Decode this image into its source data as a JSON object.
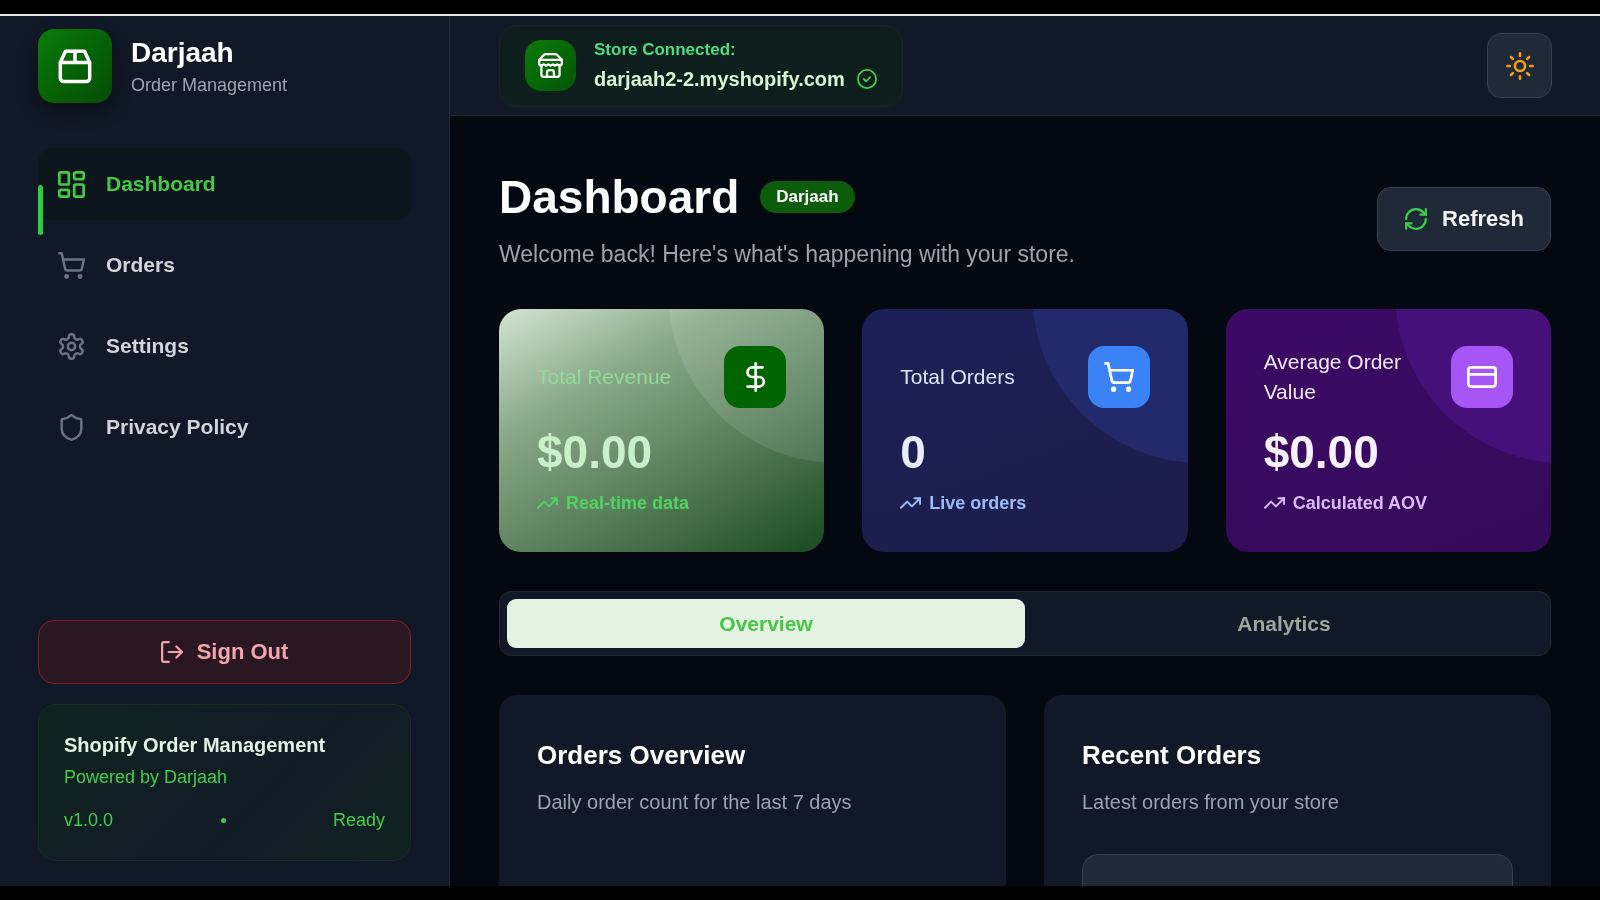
{
  "sidebar": {
    "brand": {
      "name": "Darjaah",
      "subtitle": "Order Management"
    },
    "nav": [
      {
        "label": "Dashboard",
        "selected": true
      },
      {
        "label": "Orders",
        "selected": false
      },
      {
        "label": "Settings",
        "selected": false
      },
      {
        "label": "Privacy Policy",
        "selected": false
      }
    ],
    "sign_out_button": "Sign Out",
    "footer": {
      "title": "Shopify Order Management",
      "subtitle": "Powered by Darjaah",
      "version": "v1.0.0",
      "status": "Ready"
    }
  },
  "top_bar": {
    "store": {
      "label": "Store Connected:",
      "domain": "darjaah2-2.myshopify.com",
      "verified": true
    }
  },
  "header": {
    "title": "Dashboard",
    "badge": "Darjaah",
    "subtitle": "Welcome back! Here's what's happening with your store.",
    "refresh_button": "Refresh"
  },
  "stats": [
    {
      "kind": "revenue",
      "label": "Total Revenue",
      "value": "$0.00",
      "note": "Real-time data"
    },
    {
      "kind": "orders",
      "label": "Total Orders",
      "value": "0",
      "note": "Live orders"
    },
    {
      "kind": "aov",
      "label": "Average Order Value",
      "value": "$0.00",
      "note": "Calculated AOV"
    }
  ],
  "tabs": [
    {
      "label": "Overview",
      "selected": true
    },
    {
      "label": "Analytics",
      "selected": false
    }
  ],
  "panels": [
    {
      "kind": "chart",
      "title": "Orders Overview",
      "subtitle": "Daily order count for the last 7 days"
    },
    {
      "kind": "list",
      "title": "Recent Orders",
      "subtitle": "Latest orders from your store"
    }
  ]
}
